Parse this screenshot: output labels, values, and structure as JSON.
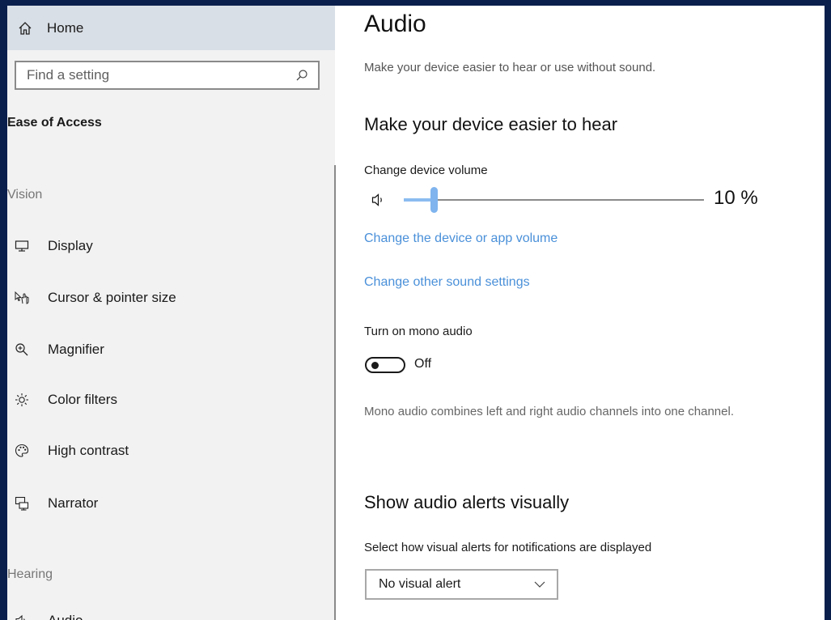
{
  "sidebar": {
    "home_label": "Home",
    "search_placeholder": "Find a setting",
    "section_title": "Ease of Access",
    "vision_label": "Vision",
    "hearing_label": "Hearing",
    "items": [
      {
        "label": "Display",
        "icon": "display-icon"
      },
      {
        "label": "Cursor & pointer size",
        "icon": "cursor-icon"
      },
      {
        "label": "Magnifier",
        "icon": "magnifier-icon"
      },
      {
        "label": "Color filters",
        "icon": "color-filters-icon"
      },
      {
        "label": "High contrast",
        "icon": "high-contrast-icon"
      },
      {
        "label": "Narrator",
        "icon": "narrator-icon"
      },
      {
        "label": "Audio",
        "icon": "audio-icon"
      }
    ]
  },
  "main": {
    "title": "Audio",
    "description": "Make your device easier to hear or use without sound.",
    "hear_heading": "Make your device easier to hear",
    "volume": {
      "label": "Change device volume",
      "value_text": "10 %",
      "level": 0.1
    },
    "links": {
      "device_app_volume": "Change the device or app volume",
      "other_sound": "Change other sound settings"
    },
    "mono": {
      "label": "Turn on mono audio",
      "state": "Off",
      "note": "Mono audio combines left and right audio channels into one channel."
    },
    "alerts": {
      "heading": "Show audio alerts visually",
      "select_label": "Select how visual alerts for notifications are displayed",
      "selected": "No visual alert"
    }
  },
  "colors": {
    "accent": "#4a90d9",
    "slider_thumb": "#7fb4ee",
    "background_frame": "#0b1f4d",
    "home_highlight": "#d9dfe6",
    "sidebar_bg": "#f2f2f2"
  }
}
